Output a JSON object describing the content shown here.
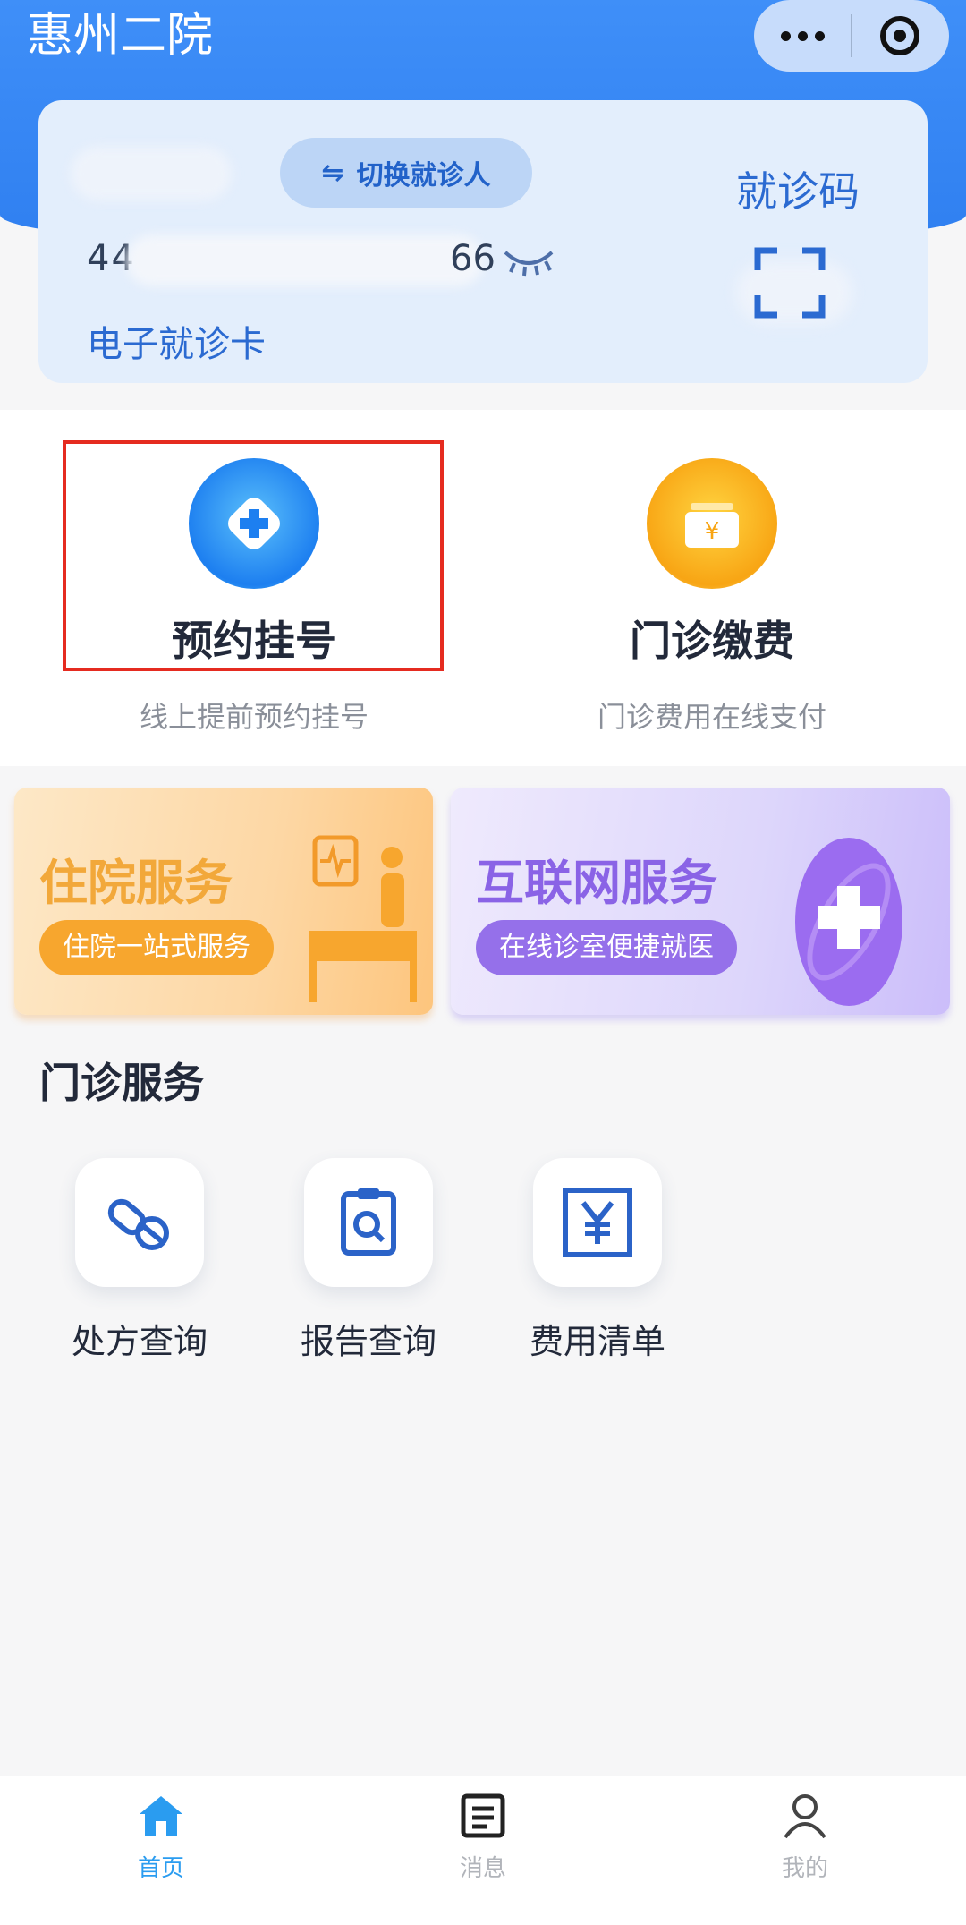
{
  "header": {
    "app_title": "惠州二院",
    "more_icon": "more-dots-icon",
    "close_icon": "target-close-icon"
  },
  "patient_card": {
    "name_visible_tail": "",
    "switch_label": "切换就诊人",
    "card_number_prefix": "44",
    "card_number_suffix": "66",
    "ecard_label": "电子就诊卡",
    "qr_label": "就诊码"
  },
  "quick_actions": [
    {
      "title": "预约挂号",
      "subtitle": "线上提前预约挂号",
      "icon": "medical-cross-icon"
    },
    {
      "title": "门诊缴费",
      "subtitle": "门诊费用在线支付",
      "icon": "yen-payment-icon"
    }
  ],
  "banners": {
    "inpatient": {
      "title": "住院服务",
      "pill": "住院一站式服务"
    },
    "internet": {
      "title": "互联网服务",
      "pill": "在线诊室便捷就医"
    }
  },
  "outpatient_services": {
    "title": "门诊服务",
    "items": [
      {
        "label": "处方查询",
        "icon": "pill-icon"
      },
      {
        "label": "报告查询",
        "icon": "report-search-icon"
      },
      {
        "label": "费用清单",
        "icon": "yen-list-icon"
      }
    ]
  },
  "tabbar": {
    "items": [
      {
        "label": "首页",
        "icon": "home-icon",
        "active": true
      },
      {
        "label": "消息",
        "icon": "message-icon",
        "active": false
      },
      {
        "label": "我的",
        "icon": "user-icon",
        "active": false
      }
    ]
  },
  "colors": {
    "primary": "#2f7ff0",
    "highlight": "#e52b20",
    "active_tab": "#2a9cf0"
  }
}
